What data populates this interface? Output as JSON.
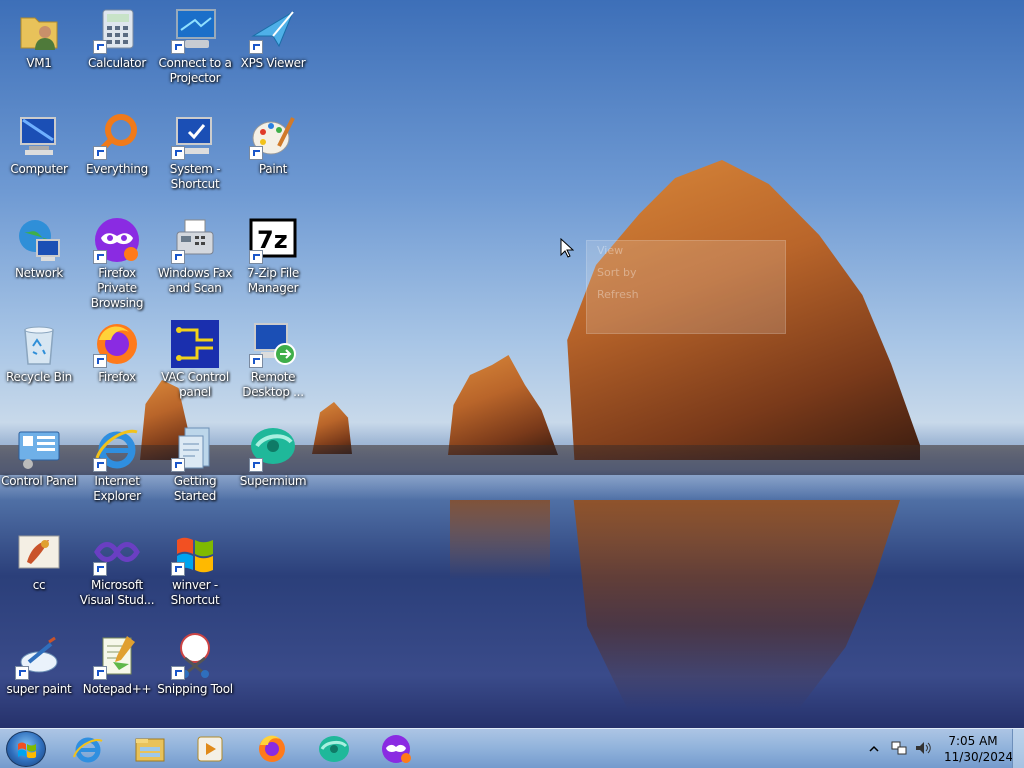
{
  "desktop": {
    "icons": [
      {
        "label": "VM1",
        "icon": "user-folder-icon"
      },
      {
        "label": "Calculator",
        "icon": "calculator-icon"
      },
      {
        "label": "Connect to a Projector",
        "icon": "projector-icon"
      },
      {
        "label": "XPS Viewer",
        "icon": "xps-viewer-icon"
      },
      {
        "label": "Computer",
        "icon": "computer-icon"
      },
      {
        "label": "Everything",
        "icon": "everything-search-icon"
      },
      {
        "label": "System - Shortcut",
        "icon": "system-icon"
      },
      {
        "label": "Paint",
        "icon": "paint-icon"
      },
      {
        "label": "Network",
        "icon": "network-icon"
      },
      {
        "label": "Firefox Private Browsing",
        "icon": "firefox-private-icon"
      },
      {
        "label": "Windows Fax and Scan",
        "icon": "fax-scan-icon"
      },
      {
        "label": "7-Zip File Manager",
        "icon": "7zip-icon"
      },
      {
        "label": "Recycle Bin",
        "icon": "recycle-bin-icon"
      },
      {
        "label": "Firefox",
        "icon": "firefox-icon"
      },
      {
        "label": "VAC Control panel",
        "icon": "vac-control-icon"
      },
      {
        "label": "Remote Desktop ...",
        "icon": "remote-desktop-icon"
      },
      {
        "label": "Control Panel",
        "icon": "control-panel-icon"
      },
      {
        "label": "Internet Explorer",
        "icon": "internet-explorer-icon"
      },
      {
        "label": "Getting Started",
        "icon": "getting-started-icon"
      },
      {
        "label": "Supermium",
        "icon": "supermium-icon"
      },
      {
        "label": "cc",
        "icon": "cc-icon"
      },
      {
        "label": "Microsoft Visual Stud...",
        "icon": "visual-studio-icon"
      },
      {
        "label": "winver - Shortcut",
        "icon": "windows-logo-icon"
      },
      {
        "label": "super paint",
        "icon": "super-paint-icon"
      },
      {
        "label": "Notepad++",
        "icon": "notepad-plus-plus-icon"
      },
      {
        "label": "Snipping Tool",
        "icon": "snipping-tool-icon"
      }
    ]
  },
  "context_menu": {
    "items": [
      "View",
      "Sort by",
      "Refresh"
    ]
  },
  "taskbar": {
    "pinned": [
      {
        "name": "Internet Explorer",
        "icon": "internet-explorer-icon"
      },
      {
        "name": "Windows Explorer",
        "icon": "folder-icon"
      },
      {
        "name": "Windows Media Player",
        "icon": "media-player-icon"
      },
      {
        "name": "Firefox",
        "icon": "firefox-icon"
      },
      {
        "name": "Supermium",
        "icon": "supermium-icon"
      },
      {
        "name": "Firefox Private Browsing",
        "icon": "firefox-private-icon"
      }
    ],
    "clock": {
      "time": "7:05 AM",
      "date": "11/30/2024"
    }
  },
  "colors": {
    "taskbar": "#9cbbe0",
    "accent": "#1a56c9"
  }
}
